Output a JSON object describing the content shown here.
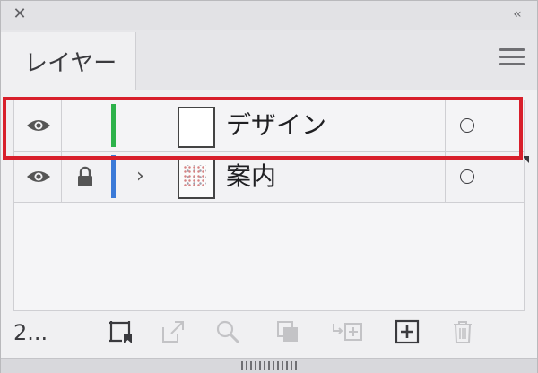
{
  "panel": {
    "close_icon": "close-icon",
    "collapse_glyph": "‹‹",
    "tab_label": "レイヤー",
    "menu_icon": "hamburger-menu-icon"
  },
  "layers": [
    {
      "name": "デザイン",
      "color": "#2db24a",
      "visible": true,
      "locked": false,
      "expandable": false,
      "selected": true
    },
    {
      "name": "案内",
      "color": "#3b7ad8",
      "visible": true,
      "locked": true,
      "expandable": true,
      "selected": false
    }
  ],
  "footer": {
    "count": "2...",
    "buttons": [
      "artboard-clip-icon",
      "export-icon",
      "search-icon",
      "make-clipping-mask-icon",
      "move-to-layer-icon",
      "new-layer-icon",
      "trash-icon"
    ]
  },
  "highlight_color": "#d81f2b"
}
